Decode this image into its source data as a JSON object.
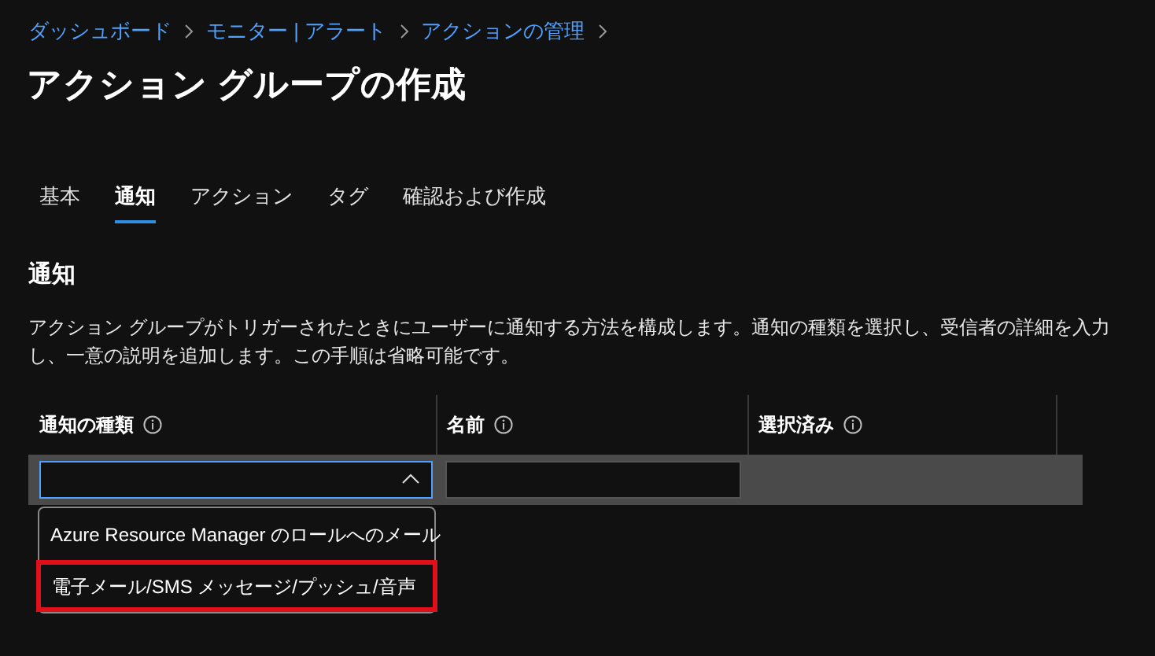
{
  "breadcrumbs": [
    "ダッシュボード",
    "モニター | アラート",
    "アクションの管理"
  ],
  "title": "アクション グループの作成",
  "tabs": [
    {
      "label": "基本",
      "selected": false
    },
    {
      "label": "通知",
      "selected": true
    },
    {
      "label": "アクション",
      "selected": false
    },
    {
      "label": "タグ",
      "selected": false
    },
    {
      "label": "確認および作成",
      "selected": false
    }
  ],
  "section": {
    "heading": "通知",
    "description": "アクション グループがトリガーされたときにユーザーに通知する方法を構成します。通知の種類を選択し、受信者の詳細を入力し、一意の説明を追加します。この手順は省略可能です。"
  },
  "table": {
    "columns": [
      "通知の種類",
      "名前",
      "選択済み"
    ],
    "row": {
      "type_dropdown": {
        "expanded": true,
        "options": [
          {
            "label": "Azure Resource Manager のロールへのメール",
            "highlighted": false
          },
          {
            "label": "電子メール/SMS メッセージ/プッシュ/音声",
            "highlighted": true
          }
        ]
      }
    }
  }
}
